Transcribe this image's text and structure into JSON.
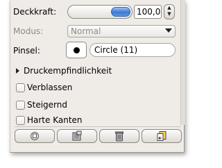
{
  "opacity": {
    "label": "Deckkraft:",
    "value": "100,0",
    "level": 1.0
  },
  "mode": {
    "label": "Modus:",
    "selected": "Normal"
  },
  "brush": {
    "label": "Pinsel:",
    "name": "Circle (11)"
  },
  "pressure": {
    "label": "Druckempfindlichkeit"
  },
  "options": [
    {
      "label": "Verblassen",
      "checked": false
    },
    {
      "label": "Steigernd",
      "checked": false
    },
    {
      "label": "Harte Kanten",
      "checked": false
    }
  ],
  "buttons": [
    {
      "icon": "save-icon"
    },
    {
      "icon": "restore-icon"
    },
    {
      "icon": "delete-icon"
    },
    {
      "icon": "reset-icon"
    }
  ]
}
